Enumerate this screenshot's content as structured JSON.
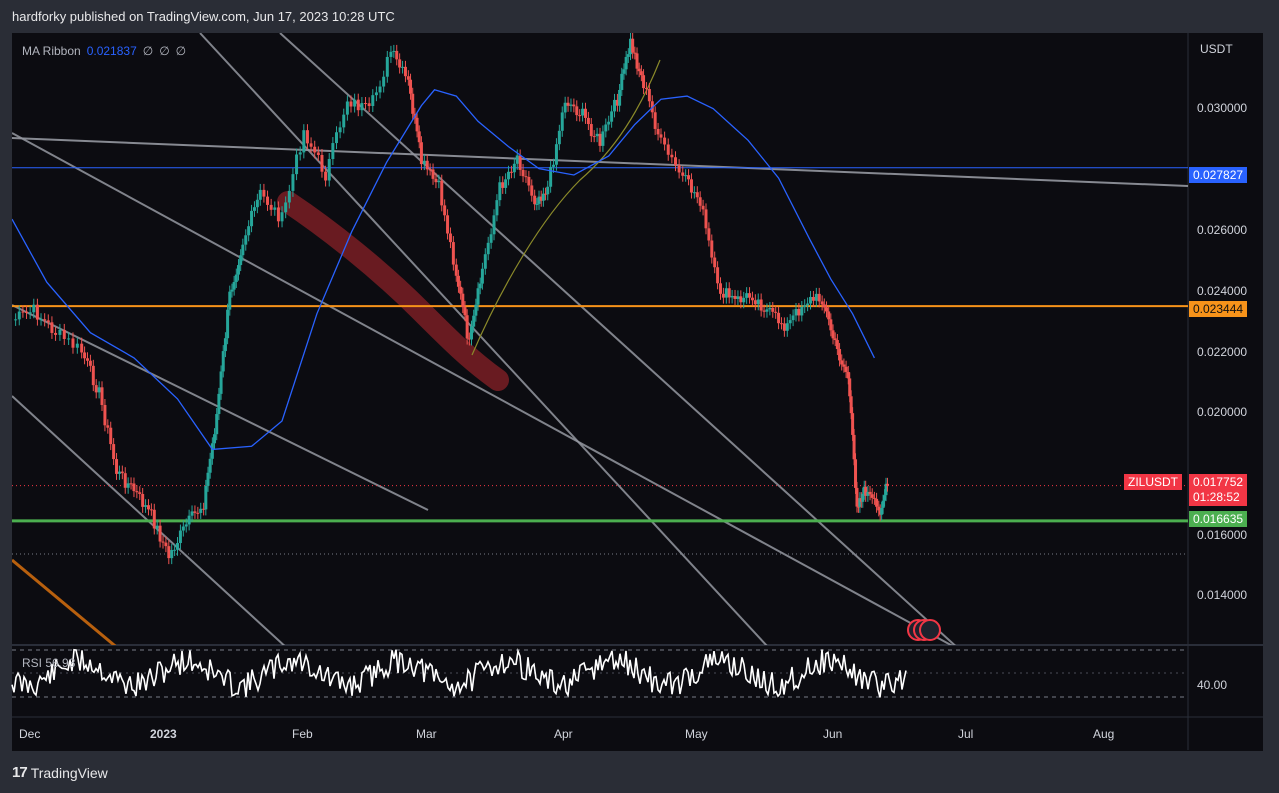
{
  "header": {
    "text": "hardforky published on TradingView.com, Jun 17, 2023 10:28 UTC"
  },
  "legend": {
    "name": "MA Ribbon",
    "value": "0.021837",
    "nulls": [
      "∅",
      "∅",
      "∅"
    ]
  },
  "rsi": {
    "label": "RSI 56.93",
    "tick": "40.00",
    "value": 56.93
  },
  "price_axis": {
    "unit": "USDT",
    "ticks": [
      "0.030000",
      "0.026000",
      "0.024000",
      "0.022000",
      "0.020000",
      "0.016000",
      "0.014000"
    ]
  },
  "time_axis": {
    "labels": [
      "Dec",
      "2023",
      "Feb",
      "Mar",
      "Apr",
      "May",
      "Jun",
      "Jul",
      "Aug"
    ]
  },
  "tags": {
    "resistance_high": {
      "value": "0.027827",
      "color": "#2962ff"
    },
    "resistance_mid": {
      "value": "0.023444",
      "color": "#f7931a"
    },
    "symbol": {
      "name": "ZILUSDT",
      "price": "0.017752",
      "countdown": "01:28:52",
      "color": "#f23645"
    },
    "support": {
      "value": "0.016635",
      "color": "#4caf50"
    }
  },
  "colors": {
    "ma_blue": "#2962ff",
    "ma_olive": "#8b8a2a",
    "channel": "#9598a1",
    "highlight": "#7a1f25",
    "rsi_line": "#ffffff"
  },
  "footer": {
    "brand": "TradingView",
    "logo": "tradingview-logo-icon"
  },
  "chart_data": {
    "type": "line",
    "title": "ZILUSDT",
    "ylabel": "USDT",
    "ylim": [
      0.0127,
      0.0321
    ],
    "xlim": [
      "2022-11-28",
      "2023-08-25"
    ],
    "horizontal_levels": [
      {
        "name": "resistance",
        "value": 0.027827,
        "color": "#2962ff"
      },
      {
        "name": "resistance",
        "value": 0.023444,
        "color": "#f7931a"
      },
      {
        "name": "support",
        "value": 0.016635,
        "color": "#4caf50"
      },
      {
        "name": "last",
        "value": 0.017752,
        "color": "#f23645"
      }
    ],
    "price": [
      [
        "2022-11-28",
        0.023
      ],
      [
        "2022-12-03",
        0.0233
      ],
      [
        "2022-12-08",
        0.0226
      ],
      [
        "2022-12-14",
        0.022
      ],
      [
        "2022-12-18",
        0.0207
      ],
      [
        "2022-12-22",
        0.0182
      ],
      [
        "2022-12-26",
        0.0176
      ],
      [
        "2022-12-30",
        0.0168
      ],
      [
        "2023-01-03",
        0.0155
      ],
      [
        "2023-01-07",
        0.0165
      ],
      [
        "2023-01-11",
        0.0172
      ],
      [
        "2023-01-14",
        0.02
      ],
      [
        "2023-01-17",
        0.0238
      ],
      [
        "2023-01-20",
        0.0255
      ],
      [
        "2023-01-24",
        0.027
      ],
      [
        "2023-01-29",
        0.0262
      ],
      [
        "2023-02-03",
        0.029
      ],
      [
        "2023-02-08",
        0.0276
      ],
      [
        "2023-02-13",
        0.03
      ],
      [
        "2023-02-18",
        0.0296
      ],
      [
        "2023-02-23",
        0.0315
      ],
      [
        "2023-02-27",
        0.0305
      ],
      [
        "2023-03-02",
        0.028
      ],
      [
        "2023-03-06",
        0.0272
      ],
      [
        "2023-03-10",
        0.0245
      ],
      [
        "2023-03-13",
        0.0222
      ],
      [
        "2023-03-16",
        0.0246
      ],
      [
        "2023-03-20",
        0.0272
      ],
      [
        "2023-03-24",
        0.0282
      ],
      [
        "2023-03-28",
        0.0268
      ],
      [
        "2023-03-31",
        0.0272
      ],
      [
        "2023-04-04",
        0.03
      ],
      [
        "2023-04-08",
        0.0295
      ],
      [
        "2023-04-12",
        0.0286
      ],
      [
        "2023-04-16",
        0.03
      ],
      [
        "2023-04-19",
        0.0318
      ],
      [
        "2023-04-22",
        0.0305
      ],
      [
        "2023-04-26",
        0.0286
      ],
      [
        "2023-05-01",
        0.0275
      ],
      [
        "2023-05-05",
        0.0268
      ],
      [
        "2023-05-09",
        0.024
      ],
      [
        "2023-05-13",
        0.0236
      ],
      [
        "2023-05-17",
        0.0238
      ],
      [
        "2023-05-21",
        0.0232
      ],
      [
        "2023-05-25",
        0.0228
      ],
      [
        "2023-05-29",
        0.0236
      ],
      [
        "2023-06-02",
        0.0237
      ],
      [
        "2023-06-05",
        0.0222
      ],
      [
        "2023-06-08",
        0.0212
      ],
      [
        "2023-06-10",
        0.0172
      ],
      [
        "2023-06-12",
        0.0176
      ],
      [
        "2023-06-15",
        0.0169
      ],
      [
        "2023-06-17",
        0.017752
      ]
    ],
    "series": [
      {
        "name": "MA Ribbon",
        "color": "#2962ff",
        "points": [
          [
            "2022-11-28",
            0.0262
          ],
          [
            "2022-12-06",
            0.0242
          ],
          [
            "2022-12-16",
            0.0226
          ],
          [
            "2022-12-26",
            0.0218
          ],
          [
            "2023-01-05",
            0.0205
          ],
          [
            "2023-01-13",
            0.0189
          ],
          [
            "2023-01-22",
            0.019
          ],
          [
            "2023-01-29",
            0.0198
          ],
          [
            "2023-02-06",
            0.0232
          ],
          [
            "2023-02-14",
            0.0258
          ],
          [
            "2023-02-22",
            0.028
          ],
          [
            "2023-03-02",
            0.0298
          ],
          [
            "2023-03-05",
            0.0303
          ],
          [
            "2023-03-10",
            0.0301
          ],
          [
            "2023-03-15",
            0.0293
          ],
          [
            "2023-03-22",
            0.0285
          ],
          [
            "2023-03-29",
            0.0278
          ],
          [
            "2023-04-06",
            0.0276
          ],
          [
            "2023-04-14",
            0.0282
          ],
          [
            "2023-04-20",
            0.0292
          ],
          [
            "2023-04-26",
            0.03
          ],
          [
            "2023-05-02",
            0.0301
          ],
          [
            "2023-05-08",
            0.0297
          ],
          [
            "2023-05-16",
            0.0287
          ],
          [
            "2023-05-23",
            0.0275
          ],
          [
            "2023-05-30",
            0.0256
          ],
          [
            "2023-06-04",
            0.0243
          ],
          [
            "2023-06-09",
            0.0232
          ],
          [
            "2023-06-14",
            0.0218
          ]
        ]
      }
    ]
  }
}
